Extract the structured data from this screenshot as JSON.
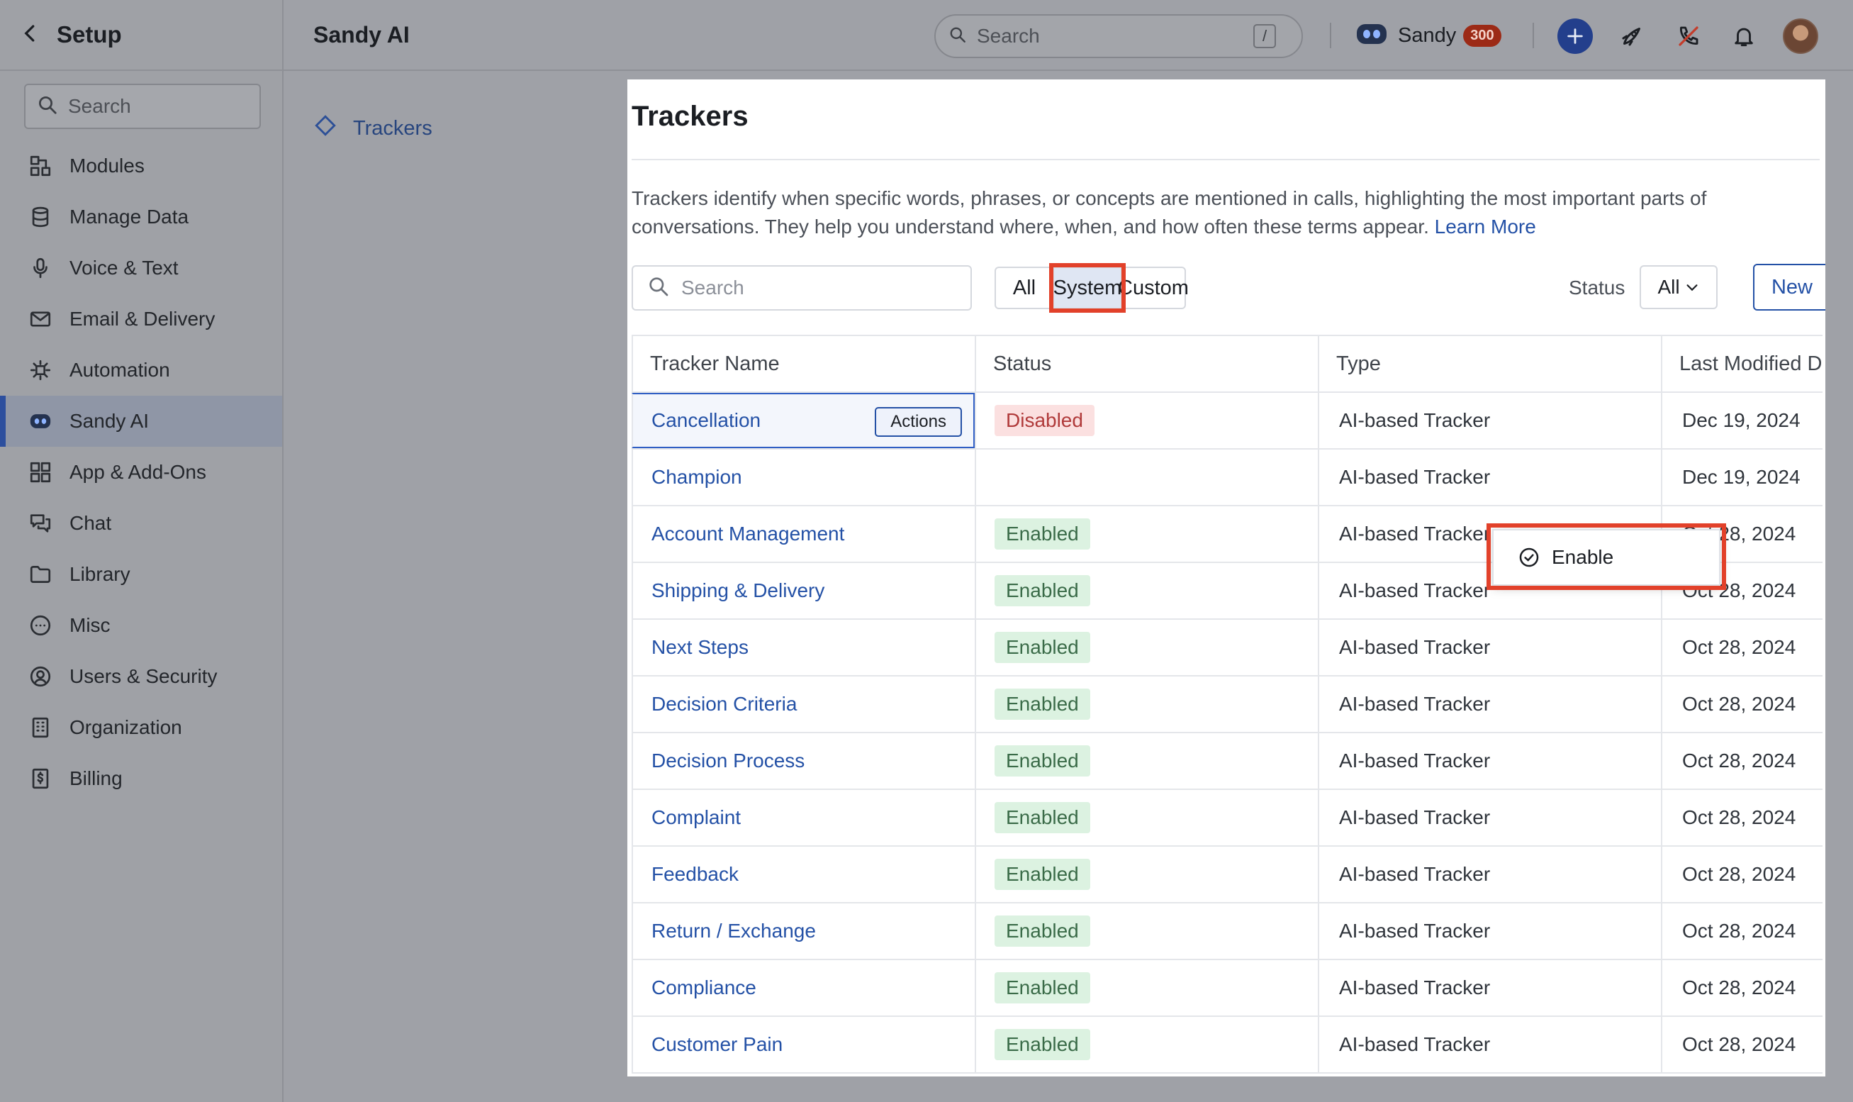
{
  "sidebar": {
    "title": "Setup",
    "search_placeholder": "Search",
    "items": [
      {
        "label": "Modules",
        "icon": "modules-icon"
      },
      {
        "label": "Manage Data",
        "icon": "database-icon"
      },
      {
        "label": "Voice & Text",
        "icon": "microphone-icon"
      },
      {
        "label": "Email & Delivery",
        "icon": "mail-icon"
      },
      {
        "label": "Automation",
        "icon": "automation-icon"
      },
      {
        "label": "Sandy AI",
        "icon": "robot-icon",
        "active": true
      },
      {
        "label": "App & Add-Ons",
        "icon": "grid-icon"
      },
      {
        "label": "Chat",
        "icon": "chat-icon"
      },
      {
        "label": "Library",
        "icon": "folder-icon"
      },
      {
        "label": "Misc",
        "icon": "more-icon"
      },
      {
        "label": "Users & Security",
        "icon": "user-circle-icon"
      },
      {
        "label": "Organization",
        "icon": "building-icon"
      },
      {
        "label": "Billing",
        "icon": "billing-icon"
      }
    ]
  },
  "header": {
    "title": "Sandy AI",
    "search_placeholder": "Search",
    "search_shortcut": "/",
    "user_name": "Sandy",
    "credits": "300"
  },
  "breadcrumb": {
    "label": "Trackers"
  },
  "main": {
    "title": "Trackers",
    "description": "Trackers identify when specific words, phrases, or concepts are mentioned in calls, highlighting the most important parts of conversations. They help you understand where, when, and how often these terms appear. ",
    "learn_more": "Learn More",
    "search_placeholder": "Search",
    "filters": [
      "All",
      "System",
      "Custom"
    ],
    "selected_filter": "System",
    "status_label": "Status",
    "status_value": "All",
    "new_label": "New",
    "actions_label": "Actions",
    "menu_enable": "Enable"
  },
  "table": {
    "columns": [
      "Tracker Name",
      "Status",
      "Type",
      "Last Modified D"
    ],
    "rows": [
      {
        "name": "Cancellation",
        "status": "Disabled",
        "type": "AI-based Tracker",
        "date": "Dec 19, 2024"
      },
      {
        "name": "Champion",
        "status": "",
        "type": "AI-based Tracker",
        "date": "Dec 19, 2024"
      },
      {
        "name": "Account Management",
        "status": "Enabled",
        "type": "AI-based Tracker",
        "date": "Oct 28, 2024"
      },
      {
        "name": "Shipping & Delivery",
        "status": "Enabled",
        "type": "AI-based Tracker",
        "date": "Oct 28, 2024"
      },
      {
        "name": "Next Steps",
        "status": "Enabled",
        "type": "AI-based Tracker",
        "date": "Oct 28, 2024"
      },
      {
        "name": "Decision Criteria",
        "status": "Enabled",
        "type": "AI-based Tracker",
        "date": "Oct 28, 2024"
      },
      {
        "name": "Decision Process",
        "status": "Enabled",
        "type": "AI-based Tracker",
        "date": "Oct 28, 2024"
      },
      {
        "name": "Complaint",
        "status": "Enabled",
        "type": "AI-based Tracker",
        "date": "Oct 28, 2024"
      },
      {
        "name": "Feedback",
        "status": "Enabled",
        "type": "AI-based Tracker",
        "date": "Oct 28, 2024"
      },
      {
        "name": "Return / Exchange",
        "status": "Enabled",
        "type": "AI-based Tracker",
        "date": "Oct 28, 2024"
      },
      {
        "name": "Compliance",
        "status": "Enabled",
        "type": "AI-based Tracker",
        "date": "Oct 28, 2024"
      },
      {
        "name": "Customer Pain",
        "status": "Enabled",
        "type": "AI-based Tracker",
        "date": "Oct 28, 2024"
      }
    ]
  },
  "colors": {
    "accent": "#2451a6",
    "highlight": "#e2412a",
    "enabled_bg": "#dcf2e1",
    "disabled_bg": "#fbe0e0",
    "credit_badge": "#9c2a16"
  }
}
